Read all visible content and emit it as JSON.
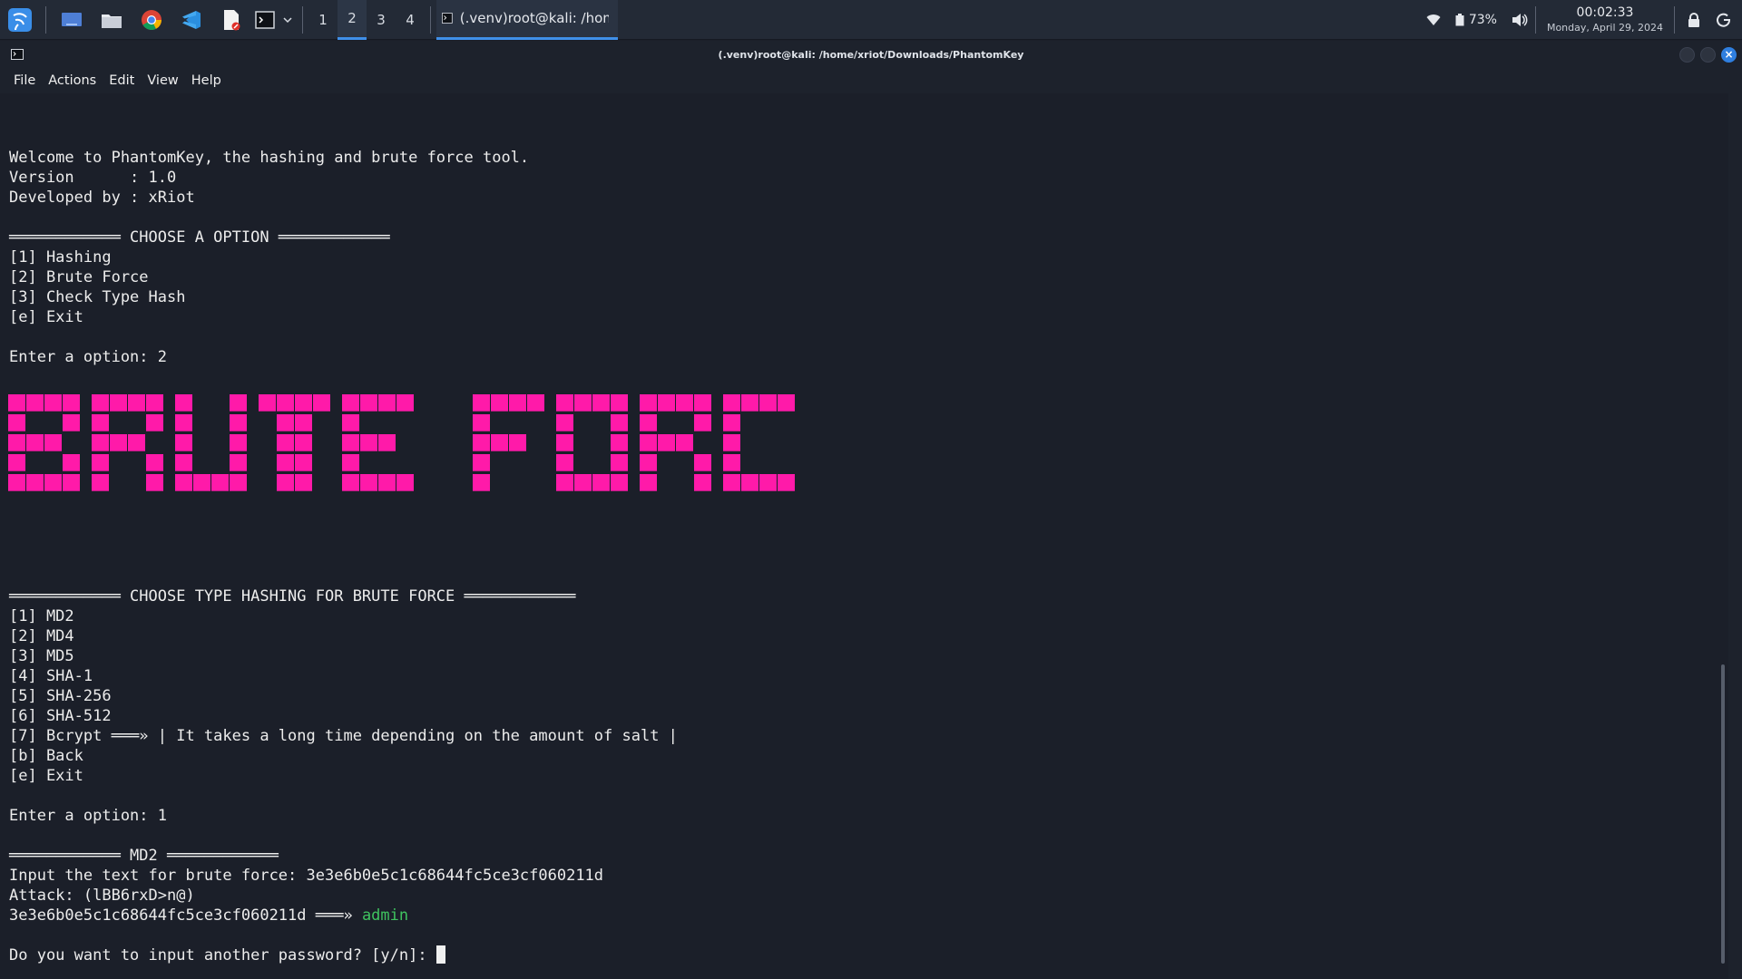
{
  "panel": {
    "workspaces": [
      "1",
      "2",
      "3",
      "4"
    ],
    "active_workspace": "2",
    "task_title": "(.venv)root@kali: /home...",
    "battery": "73%",
    "clock_time": "00:02:33",
    "clock_date": "Monday, April 29, 2024"
  },
  "window": {
    "title": "(.venv)root@kali: /home/xriot/Downloads/PhantomKey",
    "menu": [
      "File",
      "Actions",
      "Edit",
      "View",
      "Help"
    ]
  },
  "terminal": {
    "lines": [
      "Welcome to PhantomKey, the hashing and brute force tool.",
      "Version      : 1.0",
      "Developed by : xRiot",
      "",
      "════════════ CHOOSE A OPTION ════════════",
      "[1] Hashing",
      "[2] Brute Force",
      "[3] Check Type Hash",
      "[e] Exit",
      "",
      "Enter a option: 2"
    ],
    "banner_text": "BRUTE FORCE",
    "lines2": [
      "════════════ CHOOSE TYPE HASHING FOR BRUTE FORCE ════════════",
      "[1] MD2",
      "[2] MD4",
      "[3] MD5",
      "[4] SHA-1",
      "[5] SHA-256",
      "[6] SHA-512",
      "[7] Bcrypt ═══» | It takes a long time depending on the amount of salt |",
      "[b] Back",
      "[e] Exit",
      "",
      "Enter a option: 1",
      "",
      "════════════ MD2 ════════════",
      "Input the text for brute force: 3e3e6b0e5c1c68644fc5ce3cf060211d",
      "Attack: (lBB6rxD>n@)"
    ],
    "result_hash": "3e3e6b0e5c1c68644fc5ce3cf060211d ═══» ",
    "result_password": "admin",
    "prompt": "Do you want to input another password? [y/n]: ",
    "colors": {
      "banner": "#ff1aa9",
      "success": "#3fc35f",
      "background": "#1b1f29"
    }
  }
}
